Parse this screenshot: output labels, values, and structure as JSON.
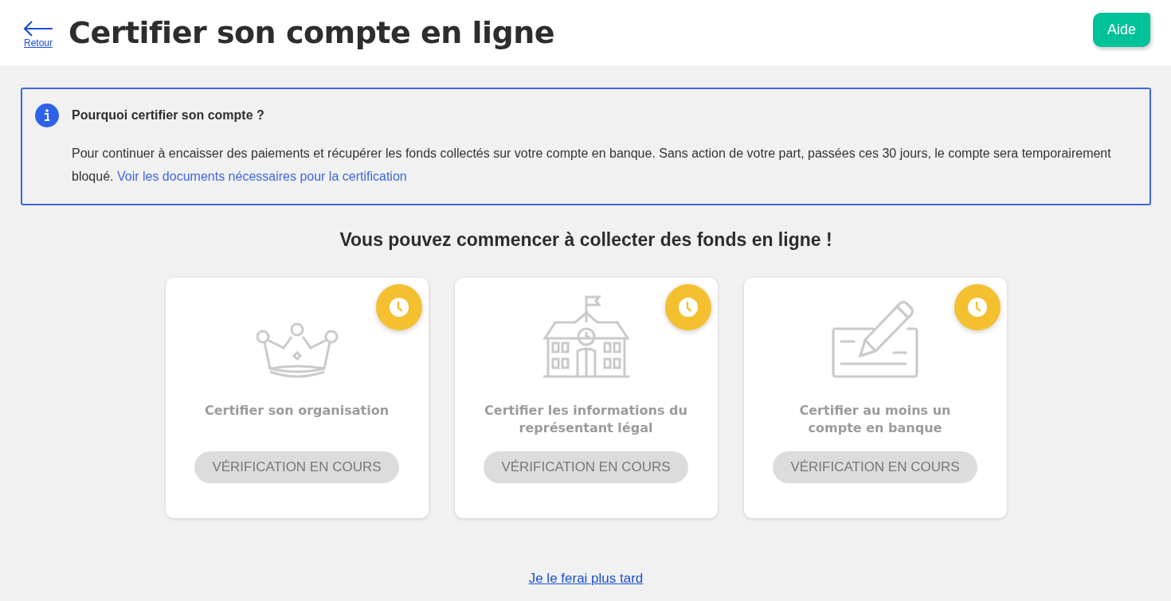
{
  "header": {
    "back_label": "Retour",
    "title": "Certifier son compte en ligne",
    "help_button": "Aide"
  },
  "info": {
    "title": "Pourquoi certifier son compte ?",
    "text": "Pour continuer à encaisser des paiements et récupérer les fonds collectés sur votre compte en banque. Sans action de votre part, passées ces 30 jours, le compte sera temporairement bloqué.",
    "link": "Voir les documents nécessaires pour la certification"
  },
  "heading": "Vous pouvez commencer à collecter des fonds en ligne !",
  "cards": [
    {
      "kind": "organization",
      "title": "Certifier son organisation",
      "pending": true,
      "button": "VÉRIFICATION EN COURS",
      "disabled": true
    },
    {
      "kind": "representative",
      "title": "Certifier les informations du représentant légal",
      "pending": true,
      "button": "VÉRIFICATION EN COURS",
      "disabled": true
    },
    {
      "kind": "bank",
      "title": "Certifier au moins un compte en banque",
      "pending": true,
      "button": "VÉRIFICATION EN COURS",
      "disabled": true
    }
  ],
  "later_link": "Je le ferai plus tard"
}
